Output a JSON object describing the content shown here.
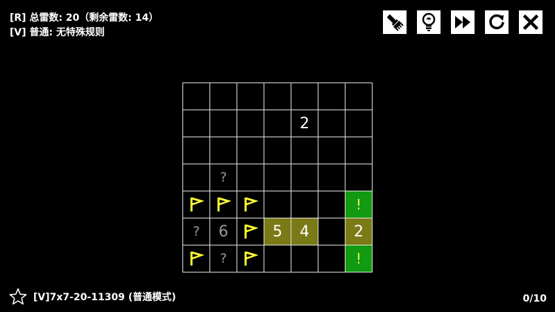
{
  "header": {
    "rule_line": "[R] 总雷数: 20（剩余雷数: 14）",
    "variant_line": "[V] 普通: 无特殊规则"
  },
  "toolbar": [
    {
      "name": "brush-icon-button",
      "icon": "brush-icon"
    },
    {
      "name": "hint-lightbulb-button",
      "icon": "lightbulb-icon"
    },
    {
      "name": "skip-forward-button",
      "icon": "fast-forward-icon"
    },
    {
      "name": "restart-button",
      "icon": "restart-icon"
    },
    {
      "name": "close-button",
      "icon": "close-icon"
    }
  ],
  "board": {
    "size": [
      7,
      7
    ],
    "cells": [
      [
        "",
        "",
        "",
        "",
        "",
        "",
        ""
      ],
      [
        "",
        "",
        "",
        "",
        "2",
        "",
        ""
      ],
      [
        "",
        "",
        "",
        "",
        "",
        "",
        ""
      ],
      [
        "",
        "?",
        "",
        "",
        "",
        "",
        ""
      ],
      [
        "F",
        "F",
        "F",
        "",
        "",
        "",
        "!"
      ],
      [
        "?",
        "6",
        "F",
        "5",
        "4",
        "",
        "2"
      ],
      [
        "F",
        "?",
        "F",
        "",
        "",
        "",
        "!"
      ]
    ],
    "highlight": [
      [
        null,
        null,
        null,
        null,
        null,
        null,
        null
      ],
      [
        null,
        null,
        null,
        null,
        null,
        null,
        null
      ],
      [
        null,
        null,
        null,
        null,
        null,
        null,
        null
      ],
      [
        null,
        null,
        null,
        null,
        null,
        null,
        null
      ],
      [
        null,
        null,
        null,
        null,
        null,
        null,
        "safe"
      ],
      [
        null,
        "grey",
        null,
        "hint",
        "hint",
        null,
        "hint"
      ],
      [
        null,
        null,
        null,
        null,
        null,
        null,
        "safe"
      ]
    ]
  },
  "footer": {
    "puzzle_id": "[V]7x7-20-11309 (普通模式)",
    "progress": "0/10"
  },
  "colors": {
    "flag": "#ffff33",
    "hint_bg": "#7a7a16",
    "safe_bg": "#129a12",
    "grid": "#e6e6e6"
  }
}
